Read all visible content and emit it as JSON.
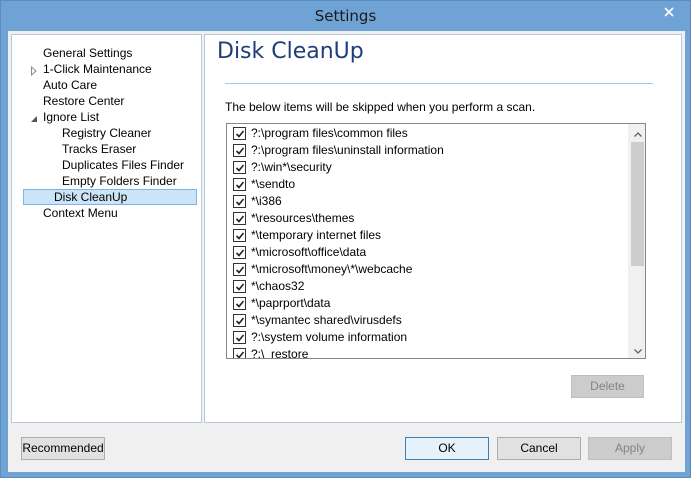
{
  "window": {
    "title": "Settings"
  },
  "nav": {
    "items": [
      {
        "label": "General Settings",
        "level": 0,
        "expander": "none"
      },
      {
        "label": "1-Click Maintenance",
        "level": 0,
        "expander": "collapsed"
      },
      {
        "label": "Auto Care",
        "level": 0,
        "expander": "none"
      },
      {
        "label": "Restore Center",
        "level": 0,
        "expander": "none"
      },
      {
        "label": "Ignore List",
        "level": 0,
        "expander": "expanded"
      },
      {
        "label": "Registry Cleaner",
        "level": 1,
        "expander": "none"
      },
      {
        "label": "Tracks Eraser",
        "level": 1,
        "expander": "none"
      },
      {
        "label": "Duplicates Files Finder",
        "level": 1,
        "expander": "none"
      },
      {
        "label": "Empty Folders Finder",
        "level": 1,
        "expander": "none"
      },
      {
        "label": "Disk CleanUp",
        "level": 1,
        "expander": "none",
        "selected": true
      },
      {
        "label": "Context Menu",
        "level": 0,
        "expander": "none"
      }
    ]
  },
  "page": {
    "title": "Disk CleanUp",
    "description": "The below items will be skipped when you perform a scan."
  },
  "skip_list": [
    {
      "path": "?:\\program files\\common files",
      "checked": true
    },
    {
      "path": "?:\\program files\\uninstall information",
      "checked": true
    },
    {
      "path": "?:\\win*\\security",
      "checked": true
    },
    {
      "path": "*\\sendto",
      "checked": true
    },
    {
      "path": "*\\i386",
      "checked": true
    },
    {
      "path": "*\\resources\\themes",
      "checked": true
    },
    {
      "path": "*\\temporary internet files",
      "checked": true
    },
    {
      "path": "*\\microsoft\\office\\data",
      "checked": true
    },
    {
      "path": "*\\microsoft\\money\\*\\webcache",
      "checked": true
    },
    {
      "path": "*\\chaos32",
      "checked": true
    },
    {
      "path": "*\\paprport\\data",
      "checked": true
    },
    {
      "path": "*\\symantec shared\\virusdefs",
      "checked": true
    },
    {
      "path": "?:\\system volume information",
      "checked": true
    },
    {
      "path": "?:\\_restore",
      "checked": true
    }
  ],
  "buttons": {
    "delete": "Delete",
    "recommended": "Recommended",
    "ok": "OK",
    "cancel": "Cancel",
    "apply": "Apply"
  },
  "colors": {
    "titlebar": "#6fa3d6",
    "accent_title": "#1e3e7a",
    "selection": "#cce4f7"
  }
}
